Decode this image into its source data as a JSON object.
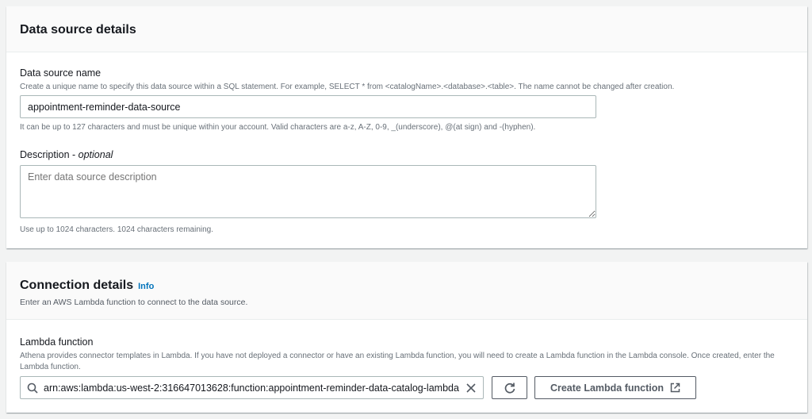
{
  "data_source": {
    "title": "Data source details",
    "name_label": "Data source name",
    "name_desc": "Create a unique name to specify this data source within a SQL statement. For example, SELECT * from <catalogName>.<database>.<table>. The name cannot be changed after creation.",
    "name_value": "appointment-reminder-data-source",
    "name_hint": "It can be up to 127 characters and must be unique within your account. Valid characters are a-z, A-Z, 0-9, _(underscore), @(at sign) and -(hyphen).",
    "desc_label": "Description - ",
    "desc_optional": "optional",
    "desc_placeholder": "Enter data source description",
    "desc_hint": "Use up to 1024 characters. 1024 characters remaining."
  },
  "connection": {
    "title": "Connection details",
    "info": "Info",
    "subtitle": "Enter an AWS Lambda function to connect to the data source.",
    "lambda_label": "Lambda function",
    "lambda_desc": "Athena provides connector templates in Lambda. If you have not deployed a connector or have an existing Lambda function, you will need to create a Lambda function in the Lambda console. Once created, enter the Lambda function.",
    "lambda_value": "arn:aws:lambda:us-west-2:316647013628:function:appointment-reminder-data-catalog-lambda",
    "create_button": "Create Lambda function"
  }
}
